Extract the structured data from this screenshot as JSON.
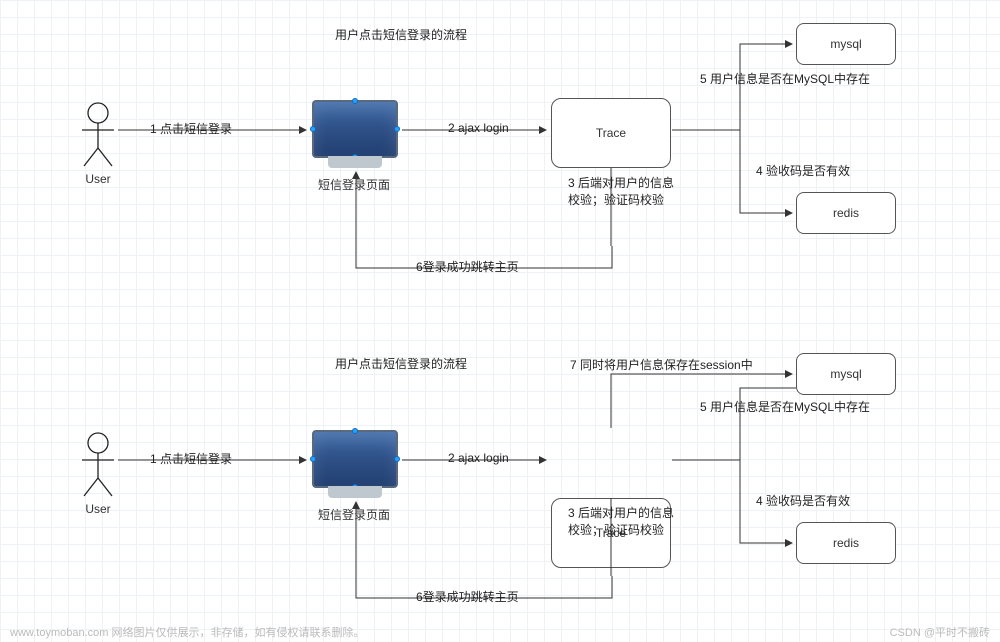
{
  "diagram1": {
    "title": "用户点击短信登录的流程",
    "user_label": "User",
    "monitor_caption": "短信登录页面",
    "trace_label": "Trace",
    "mysql_label": "mysql",
    "redis_label": "redis",
    "edges": {
      "e1": "1 点击短信登录",
      "e2": "2 ajax login",
      "e3": "3 后端对用户的信息校验；验证码校验",
      "e4": "4 验收码是否有效",
      "e5": "5 用户信息是否在MySQL中存在",
      "e6": "6登录成功跳转主页"
    }
  },
  "diagram2": {
    "title": "用户点击短信登录的流程",
    "user_label": "User",
    "monitor_caption": "短信登录页面",
    "trace_label": "Trace",
    "mysql_label": "mysql",
    "redis_label": "redis",
    "edges": {
      "e1": "1 点击短信登录",
      "e2": "2 ajax login",
      "e3": "3 后端对用户的信息校验；验证码校验",
      "e4": "4 验收码是否有效",
      "e5": "5 用户信息是否在MySQL中存在",
      "e6": "6登录成功跳转主页",
      "e7": "7 同时将用户信息保存在session中"
    }
  },
  "footer": {
    "left": "www.toymoban.com 网络图片仅供展示，非存储，如有侵权请联系删除。",
    "right": "CSDN @平时不搬砖"
  }
}
